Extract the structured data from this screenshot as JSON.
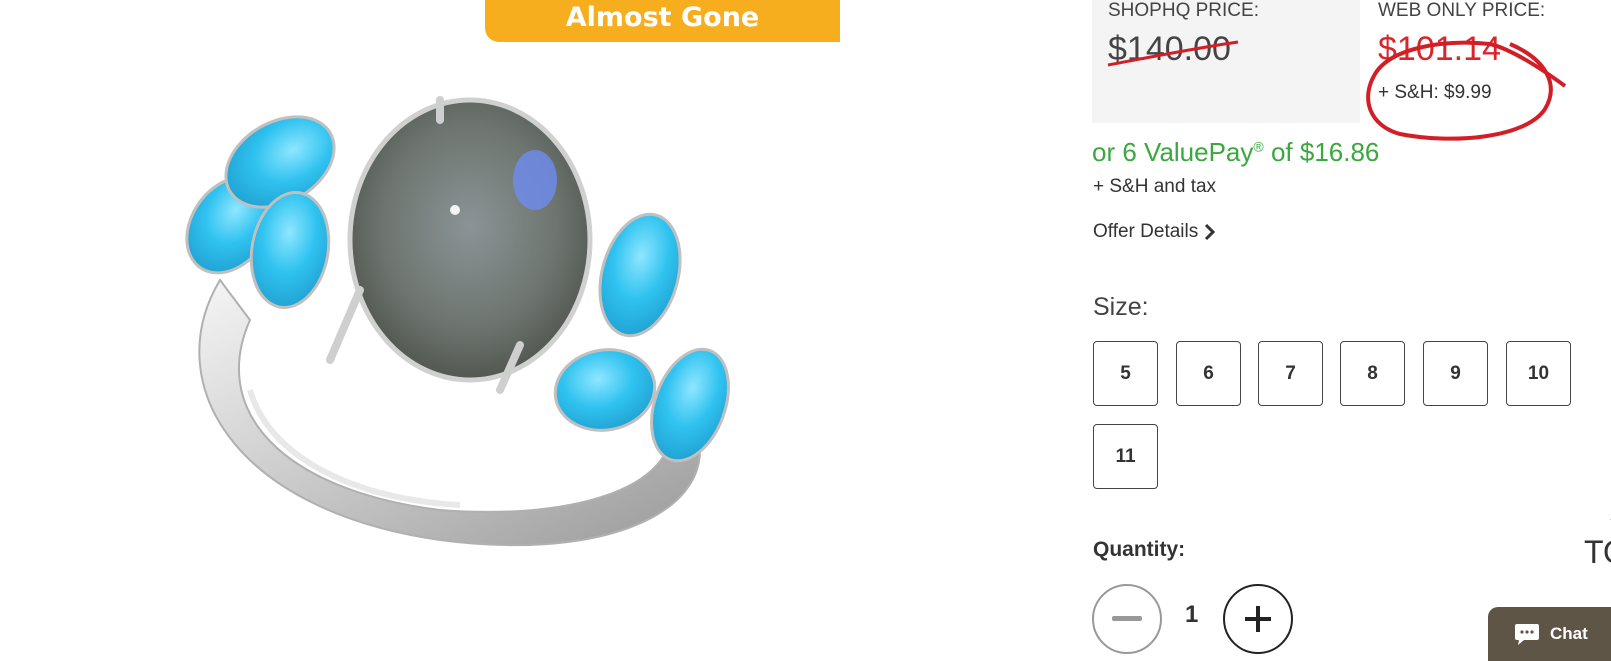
{
  "badge": {
    "label": "Almost Gone"
  },
  "prices": {
    "shophq_label": "SHOPHQ PRICE:",
    "shophq_price": "$140.00",
    "web_label": "WEB ONLY PRICE:",
    "web_price": "$101.14",
    "shipping": "+ S&H: $9.99"
  },
  "valuepay": {
    "prefix": "or 6 ValuePay",
    "reg": "®",
    "suffix": " of $16.86",
    "note": "+ S&H and tax"
  },
  "offer_details": {
    "label": "Offer Details"
  },
  "size": {
    "label": "Size:",
    "options": [
      "5",
      "6",
      "7",
      "8",
      "9",
      "10",
      "11"
    ]
  },
  "quantity": {
    "label": "Quantity:",
    "value": "1"
  },
  "to_top": {
    "label": "TO"
  },
  "chat": {
    "label": "Chat"
  },
  "colors": {
    "badge": "#f6ae1e",
    "web_price": "#d9262b",
    "valuepay": "#3aa83e",
    "chat_bg": "#5e5547",
    "annotation": "#d21e26"
  },
  "icons": {
    "offer_details": "chevron-right-icon",
    "qty_minus": "minus-icon",
    "qty_plus": "plus-icon",
    "chat": "chat-bubble-icon",
    "to_top": "arrow-up-icon"
  }
}
